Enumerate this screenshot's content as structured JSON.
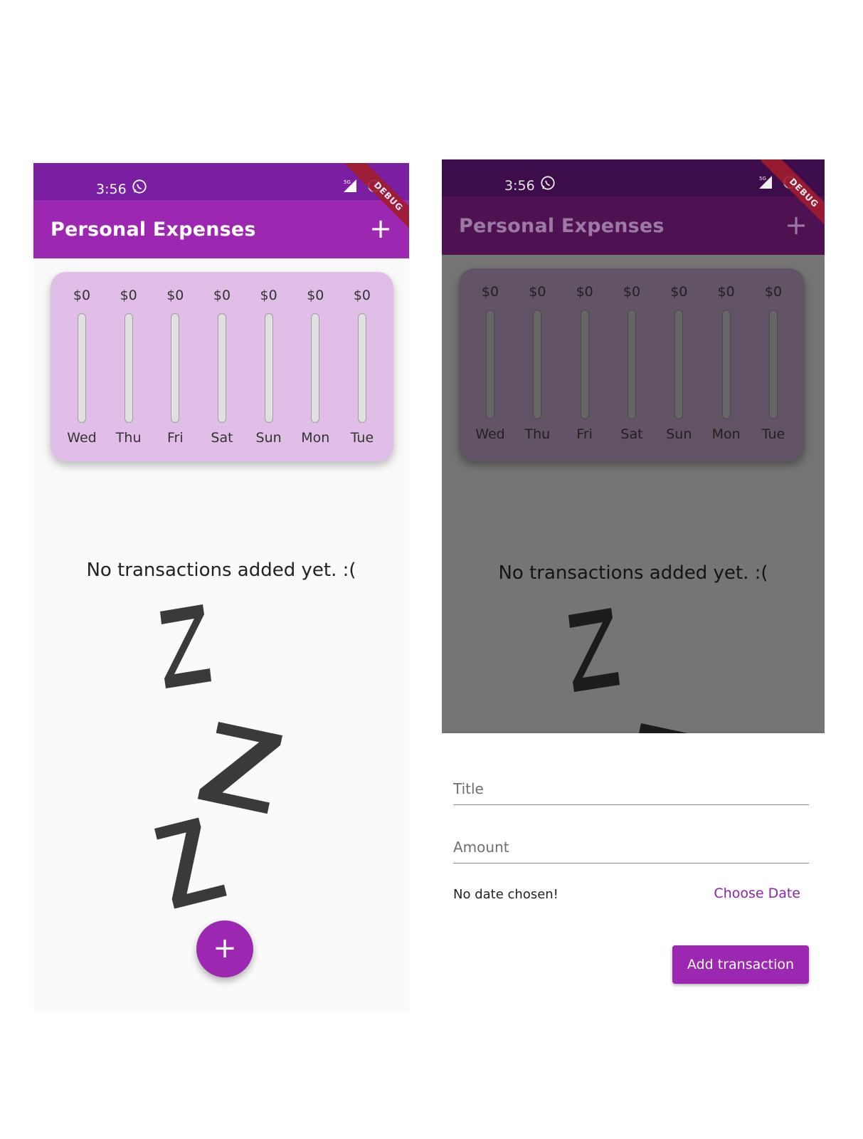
{
  "colors": {
    "primary": "#9c27b0",
    "primary_dark": "#7b1fa2",
    "chart_card": "#e1bee7",
    "accent_text": "#8e24aa",
    "debug_ribbon": "#a11d2e"
  },
  "status_bar": {
    "time": "3:56",
    "network": "5G"
  },
  "debug_banner": "DEBUG",
  "app_bar": {
    "title": "Personal Expenses",
    "add_icon": "plus-icon"
  },
  "chart": {
    "bars": [
      {
        "day": "Wed",
        "amount": "$0",
        "fill": 0
      },
      {
        "day": "Thu",
        "amount": "$0",
        "fill": 0
      },
      {
        "day": "Fri",
        "amount": "$0",
        "fill": 0
      },
      {
        "day": "Sat",
        "amount": "$0",
        "fill": 0
      },
      {
        "day": "Sun",
        "amount": "$0",
        "fill": 0
      },
      {
        "day": "Mon",
        "amount": "$0",
        "fill": 0
      },
      {
        "day": "Tue",
        "amount": "$0",
        "fill": 0
      }
    ]
  },
  "empty_state": {
    "message": "No transactions added yet. :(",
    "image_icon": "zzz-icon"
  },
  "fab": {
    "icon": "plus-icon",
    "label": "+"
  },
  "new_transaction_form": {
    "title_placeholder": "Title",
    "amount_placeholder": "Amount",
    "date_label": "No date chosen!",
    "choose_date_label": "Choose Date",
    "submit_label": "Add transaction"
  }
}
